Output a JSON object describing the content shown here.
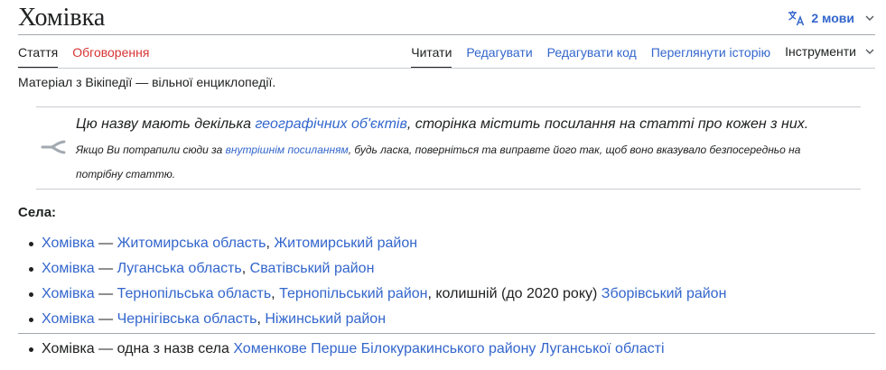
{
  "page": {
    "title": "Хомівка",
    "languages_label": "2 мови",
    "tagline": "Матеріал з Вікіпедії — вільної енциклопедії."
  },
  "tabs": {
    "left": [
      "Стаття",
      "Обговорення"
    ],
    "right": [
      "Читати",
      "Редагувати",
      "Редагувати код",
      "Переглянути історію",
      "Інструменти"
    ]
  },
  "disambig": {
    "main_before": "Цю назву мають декілька ",
    "main_link": "географічних об'єктів",
    "main_after": ", сторінка містить посилання на статті про кожен з них.",
    "sub_before": "Якщо Ви потрапили сюди за ",
    "sub_link": "внутрішнім посиланням",
    "sub_after": ", будь ласка, поверніться та виправте його так, щоб воно вказувало безпосередньо на потрібну статтю."
  },
  "section_label": "Села:",
  "villages": [
    {
      "name": "Хомівка",
      "dash": " — ",
      "oblast": "Житомирська область",
      "sep": ", ",
      "raion": "Житомирський район",
      "extra": "",
      "extra_link": ""
    },
    {
      "name": "Хомівка",
      "dash": " — ",
      "oblast": "Луганська область",
      "sep": ", ",
      "raion": "Сватівський район",
      "extra": "",
      "extra_link": ""
    },
    {
      "name": "Хомівка",
      "dash": " — ",
      "oblast": "Тернопільська область",
      "sep": ", ",
      "raion": "Тернопільський район",
      "extra": ", колишній (до 2020 року) ",
      "extra_link": "Зборівський район"
    },
    {
      "name": "Хомівка",
      "dash": " — ",
      "oblast": "Чернігівська область",
      "sep": ", ",
      "raion": "Ніжинський район",
      "extra": "",
      "extra_link": ""
    }
  ],
  "other": {
    "text": "Хомівка — одна з назв села ",
    "link": "Хоменкове Перше Білокуракинського району Луганської області"
  },
  "colors": {
    "link": "#3366cc",
    "new_link": "#d73333",
    "text": "#202122"
  }
}
